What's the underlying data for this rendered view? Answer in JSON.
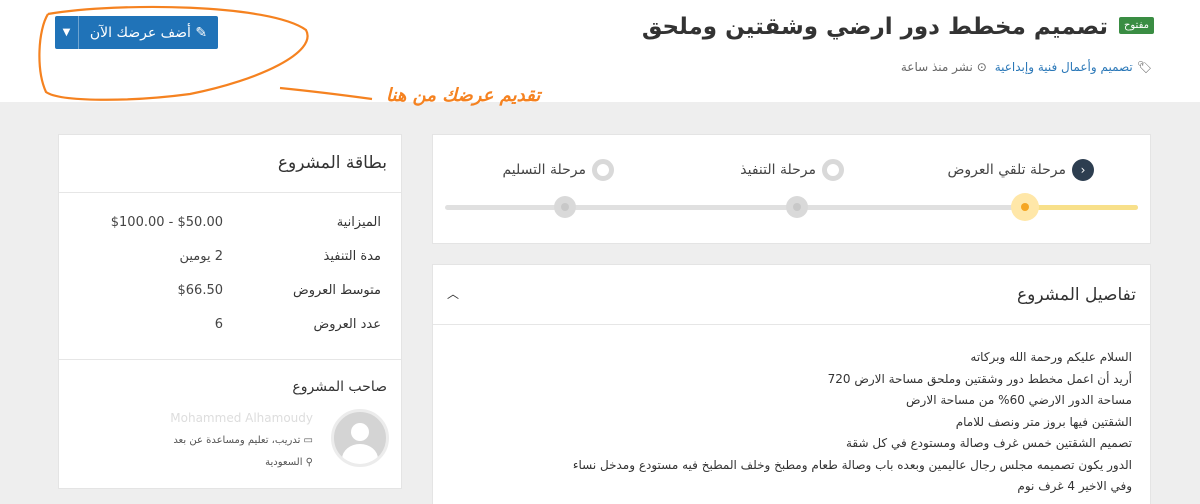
{
  "header": {
    "status_badge": "مفتوح",
    "title": "تصميم مخطط دور ارضي وشقتين وملحق",
    "category": "تصميم وأعمال فنية وإبداعية",
    "published": "نشر منذ ساعة",
    "offer_button": "أضف عرضك الآن",
    "annotation": "تقديم عرضك من هنا"
  },
  "stages": {
    "items": [
      {
        "label": "مرحلة تلقي العروض",
        "state": "active"
      },
      {
        "label": "مرحلة التنفيذ",
        "state": "pending"
      },
      {
        "label": "مرحلة التسليم",
        "state": "pending"
      }
    ],
    "progress": 0.17
  },
  "details": {
    "title": "تفاصيل المشروع",
    "lines": [
      "السلام عليكم ورحمة الله وبركاته",
      "أريد أن اعمل مخطط دور وشقتين وملحق مساحة الارض 720",
      "مساحة الدور الارضي 60% من مساحة الارض",
      "الشقتين فيها بروز متر ونصف للامام",
      "تصميم الشقتين خمس غرف وصالة ومستودع في كل شقة",
      "الدور يكون تصميمه مجلس رجال عاليمين وبعده باب وصالة طعام ومطبخ وخلف المطبخ فيه مستودع ومدخل نساء",
      "وفي الاخير 4 غرف نوم"
    ]
  },
  "card": {
    "title": "بطاقة المشروع",
    "rows": [
      {
        "key": "الميزانية",
        "value": "$50.00 - $100.00"
      },
      {
        "key": "مدة التنفيذ",
        "value": "2 يومين"
      },
      {
        "key": "متوسط العروض",
        "value": "$66.50"
      },
      {
        "key": "عدد العروض",
        "value": "6"
      }
    ],
    "owner_title": "صاحب المشروع",
    "owner_name": "Mohammed Alhamoudy",
    "owner_role": "تدريب، تعليم ومساعدة عن بعد",
    "owner_location": "السعودية"
  },
  "colors": {
    "accent": "#2073b8",
    "badge": "#3a8d43",
    "annotation": "#f58220",
    "stage_active": "#f5a623"
  }
}
